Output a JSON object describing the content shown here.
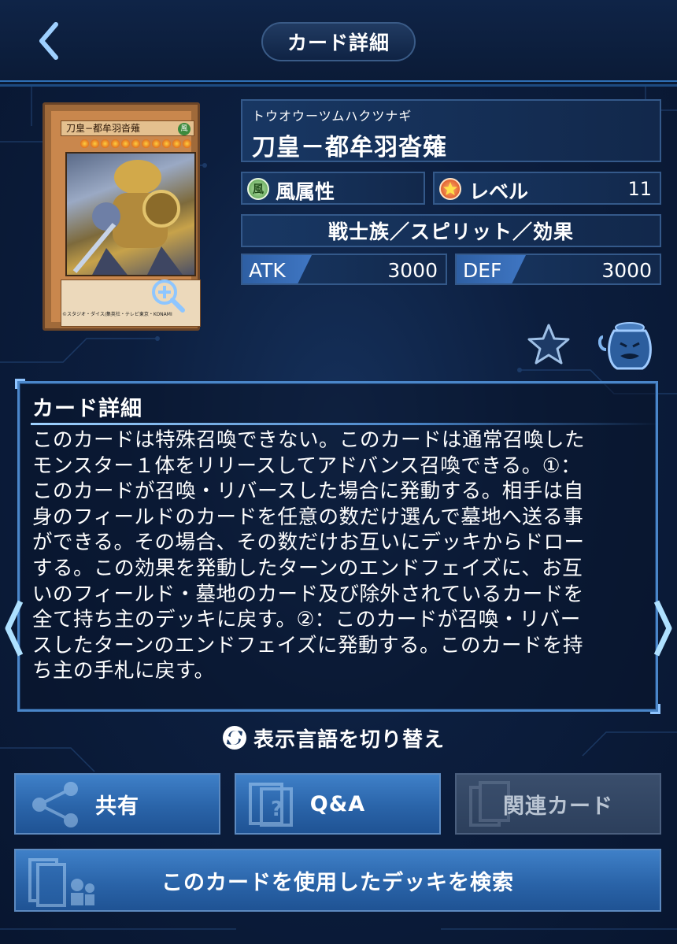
{
  "header": {
    "title": "カード詳細"
  },
  "card": {
    "image_name": "刀皇−都牟羽沓薙",
    "image_attribute": "風",
    "image_copyright": "©スタジオ・ダイス/集英社・テレビ東京・KONAMI",
    "reading": "トウオウーツムハクツナギ",
    "name": "刀皇－都牟羽沓薙",
    "attribute": "風属性",
    "attribute_icon_char": "風",
    "level_label": "レベル",
    "level": "11",
    "type_line": "戦士族／スピリット／効果",
    "atk_label": "ATK",
    "atk": "3000",
    "def_label": "DEF",
    "def": "3000",
    "stars": 11
  },
  "description": {
    "title": "カード詳細",
    "lines": [
      "このカードは特殊召喚できない。このカードは通常召喚した",
      "モンスター１体をリリースしてアドバンス召喚できる。①：",
      "このカードが召喚・リバースした場合に発動する。相手は自",
      "身のフィールドのカードを任意の数だけ選んで墓地へ送る事",
      "ができる。その場合、その数だけお互いにデッキからドロー",
      "する。この効果を発動したターンのエンドフェイズに、お互",
      "いのフィールド・墓地のカード及び除外されているカードを",
      "全て持ち主のデッキに戻す。②：このカードが召喚・リバー",
      "スしたターンのエンドフェイズに発動する。このカードを持",
      "ち主の手札に戻す。"
    ]
  },
  "lang_toggle": "表示言語を切り替え",
  "buttons": {
    "share": "共有",
    "qa": "Q&A",
    "related": "関連カード",
    "search_deck": "このカードを使用したデッキを検索"
  },
  "colors": {
    "accent": "#4a86c9",
    "button": "#2a64a9",
    "disabled": "#2c3f5c"
  }
}
